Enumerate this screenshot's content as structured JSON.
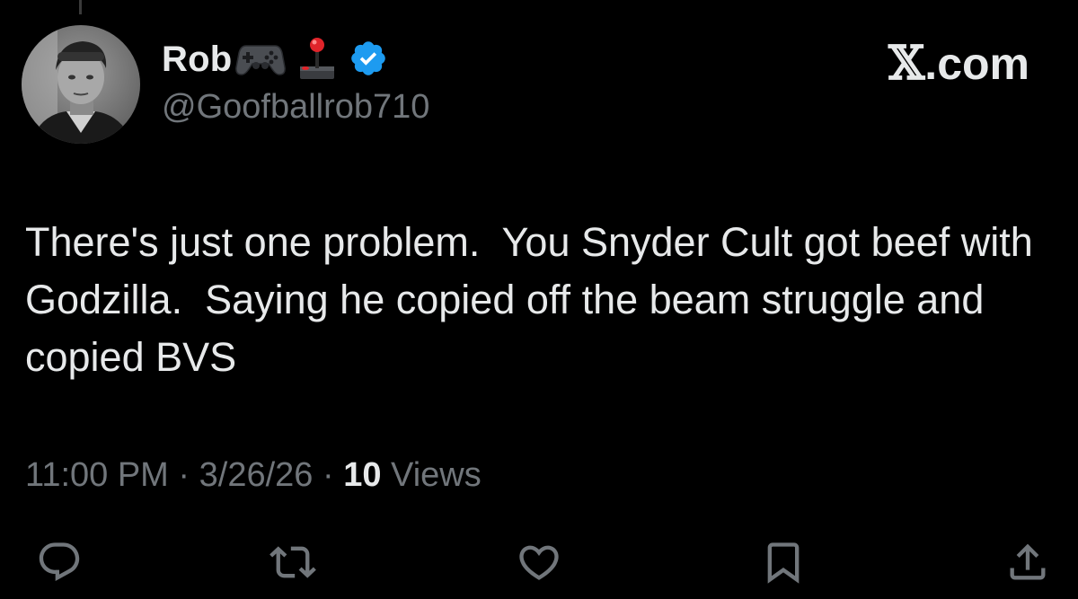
{
  "author": {
    "display_name": "Rob",
    "handle": "@Goofballrob710",
    "name_icons": [
      "game-controller-icon",
      "joystick-icon",
      "verified-badge-icon"
    ],
    "avatar": "avatar"
  },
  "site_label": {
    "x_glyph": "𝕏",
    "text": ".com"
  },
  "tweet": {
    "text": "There's just one problem.  You Snyder Cult got beef with Godzilla.  Saying he copied off the beam struggle and copied BVS"
  },
  "meta": {
    "time": "11:00 PM",
    "separator1": " · ",
    "date": "3/26/26",
    "separator2": " · ",
    "views_count": "10",
    "views_label": " Views"
  },
  "actions": [
    "reply-icon",
    "repost-icon",
    "like-icon",
    "bookmark-icon",
    "share-icon"
  ],
  "colors": {
    "background": "#000000",
    "text": "#e7e9ea",
    "secondary": "#71767b",
    "verified": "#1d9bf0"
  }
}
